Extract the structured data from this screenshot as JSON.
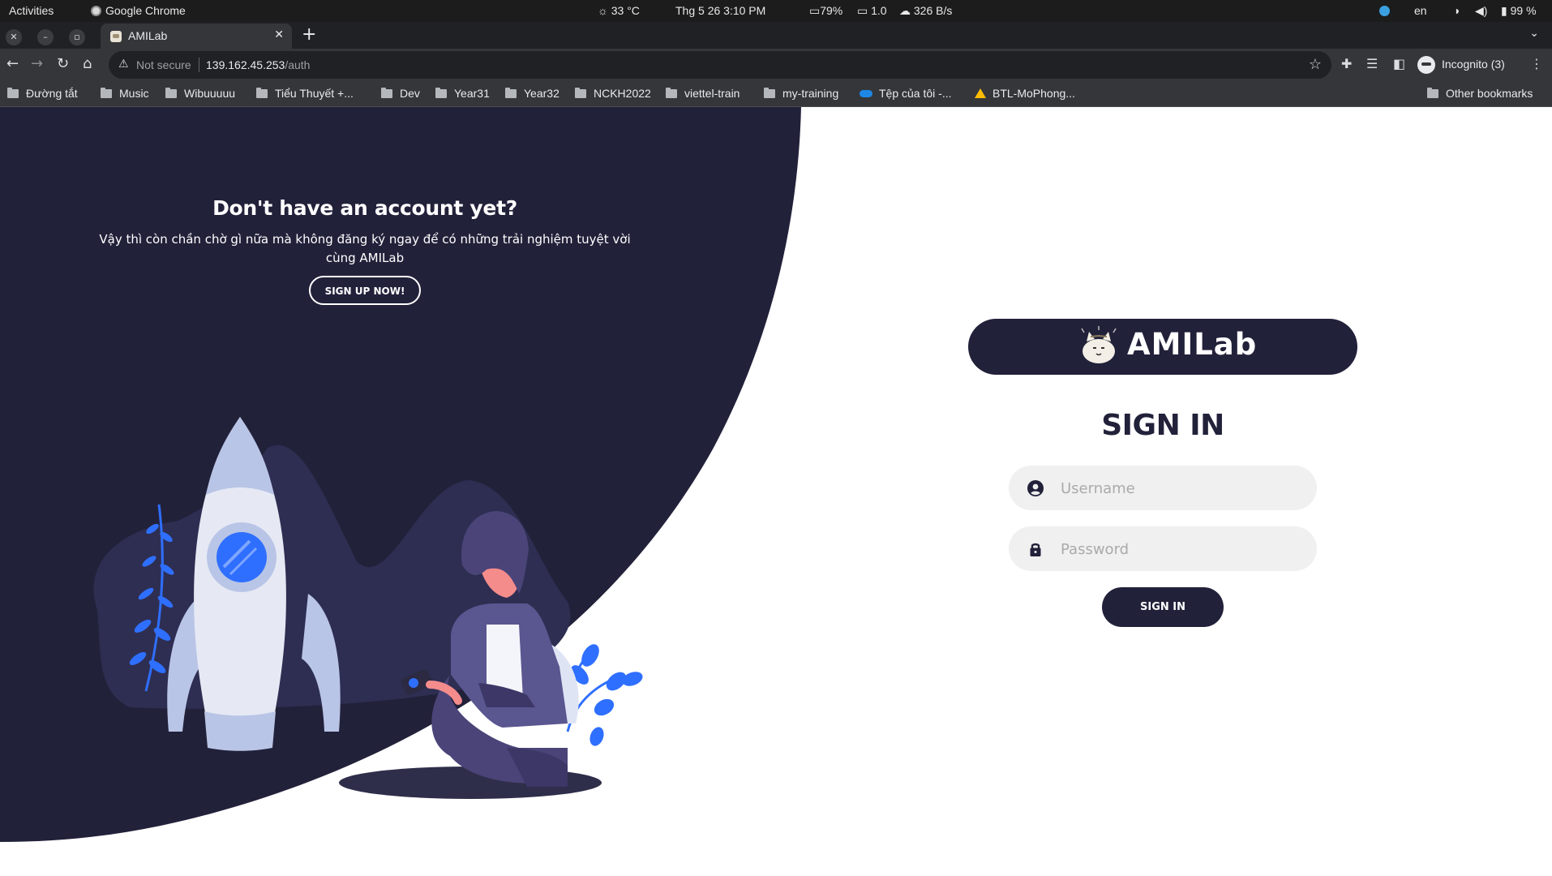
{
  "system_bar": {
    "activities": "Activities",
    "app_name": "Google Chrome",
    "weather": "33 °C",
    "datetime": "Thg 5 26   3:10 PM",
    "battery_saver": "79%",
    "load": "1.0",
    "network": "326 B/s",
    "language": "en",
    "battery": "99 %"
  },
  "browser": {
    "tab_title": "AMILab",
    "security_label": "Not secure",
    "url_host": "139.162.45.253",
    "url_path": "/auth",
    "profile_label": "Incognito (3)",
    "bookmarks": [
      "Đường tắt",
      "Music",
      "Wibuuuuu",
      "Tiểu Thuyết +...",
      "Dev",
      "Year31",
      "Year32",
      "NCKH2022",
      "viettel-train",
      "my-training",
      "Tệp của tôi -...",
      "BTL-MoPhong..."
    ],
    "other_bookmarks": "Other bookmarks"
  },
  "promo": {
    "heading": "Don't have an account yet?",
    "text": "Vậy thì còn chần chờ gì nữa mà không đăng ký ngay để có những trải nghiệm tuyệt vời cùng AMILab",
    "button": "SIGN UP NOW!"
  },
  "login": {
    "brand": "AMILab",
    "title": "SIGN IN",
    "username_placeholder": "Username",
    "password_placeholder": "Password",
    "button": "SIGN IN"
  },
  "colors": {
    "navy": "#22213a",
    "accent_blue": "#2f6fff",
    "input_bg": "#f0f0f0"
  }
}
